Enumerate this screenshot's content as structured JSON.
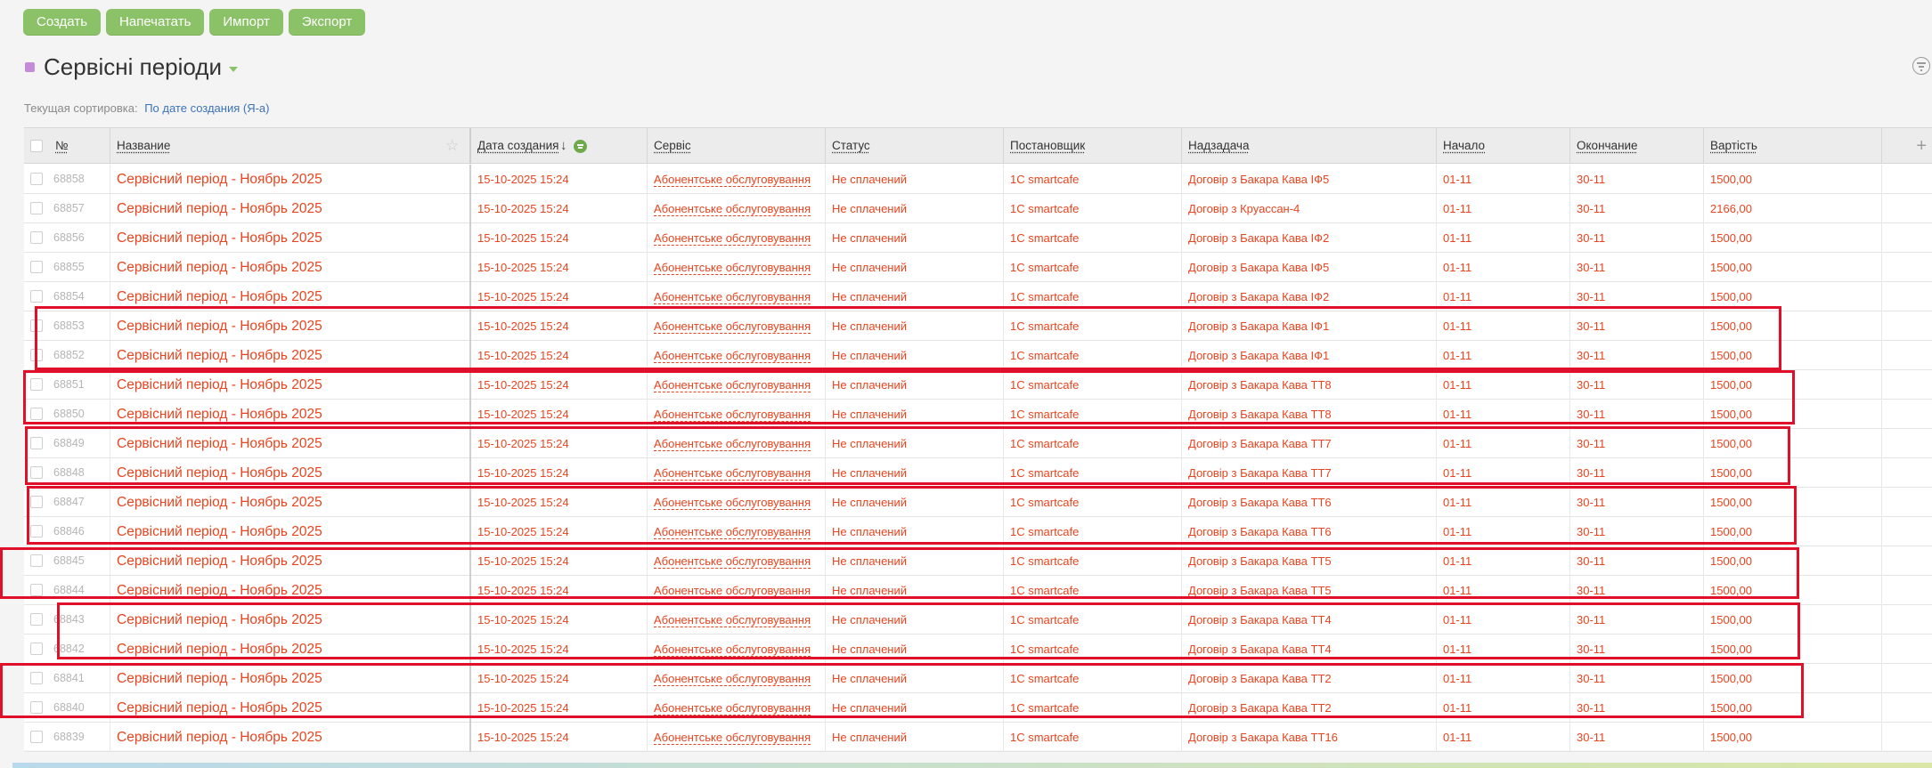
{
  "toolbar": {
    "create": "Создать",
    "print": "Напечатать",
    "import": "Импорт",
    "export": "Экспорт"
  },
  "page_title": "Сервісні періоди",
  "sort": {
    "label": "Текущая сортировка:",
    "value": "По дате создания (Я-а)"
  },
  "columns": {
    "num": "№",
    "name": "Название",
    "created": "Дата создания",
    "service": "Сервіс",
    "status": "Статус",
    "author": "Постановщик",
    "parent": "Надзадача",
    "start": "Начало",
    "end": "Окончание",
    "cost": "Вартість"
  },
  "sort_arrow": "↓",
  "rows": [
    {
      "num": "68858",
      "name": "Сервісний період - Ноябрь 2025",
      "created": "15-10-2025 15:24",
      "service": "Абонентське обслуговування",
      "status": "Не сплачений",
      "author": "1C smartcafe",
      "parent": "Договір з Бакара Кава IФ5",
      "start": "01-11",
      "end": "30-11",
      "cost": "1500,00"
    },
    {
      "num": "68857",
      "name": "Сервісний період - Ноябрь 2025",
      "created": "15-10-2025 15:24",
      "service": "Абонентське обслуговування",
      "status": "Не сплачений",
      "author": "1C smartcafe",
      "parent": "Договір з Круассан-4",
      "start": "01-11",
      "end": "30-11",
      "cost": "2166,00"
    },
    {
      "num": "68856",
      "name": "Сервісний період - Ноябрь 2025",
      "created": "15-10-2025 15:24",
      "service": "Абонентське обслуговування",
      "status": "Не сплачений",
      "author": "1C smartcafe",
      "parent": "Договір з Бакара Кава IФ2",
      "start": "01-11",
      "end": "30-11",
      "cost": "1500,00"
    },
    {
      "num": "68855",
      "name": "Сервісний період - Ноябрь 2025",
      "created": "15-10-2025 15:24",
      "service": "Абонентське обслуговування",
      "status": "Не сплачений",
      "author": "1C smartcafe",
      "parent": "Договір з Бакара Кава IФ5",
      "start": "01-11",
      "end": "30-11",
      "cost": "1500,00"
    },
    {
      "num": "68854",
      "name": "Сервісний період - Ноябрь 2025",
      "created": "15-10-2025 15:24",
      "service": "Абонентське обслуговування",
      "status": "Не сплачений",
      "author": "1C smartcafe",
      "parent": "Договір з Бакара Кава IФ2",
      "start": "01-11",
      "end": "30-11",
      "cost": "1500,00"
    },
    {
      "num": "68853",
      "name": "Сервісний період - Ноябрь 2025",
      "created": "15-10-2025 15:24",
      "service": "Абонентське обслуговування",
      "status": "Не сплачений",
      "author": "1C smartcafe",
      "parent": "Договір з Бакара Кава IФ1",
      "start": "01-11",
      "end": "30-11",
      "cost": "1500,00"
    },
    {
      "num": "68852",
      "name": "Сервісний період - Ноябрь 2025",
      "created": "15-10-2025 15:24",
      "service": "Абонентське обслуговування",
      "status": "Не сплачений",
      "author": "1C smartcafe",
      "parent": "Договір з Бакара Кава IФ1",
      "start": "01-11",
      "end": "30-11",
      "cost": "1500,00"
    },
    {
      "num": "68851",
      "name": "Сервісний період - Ноябрь 2025",
      "created": "15-10-2025 15:24",
      "service": "Абонентське обслуговування",
      "status": "Не сплачений",
      "author": "1C smartcafe",
      "parent": "Договір з Бакара Кава ТТ8",
      "start": "01-11",
      "end": "30-11",
      "cost": "1500,00"
    },
    {
      "num": "68850",
      "name": "Сервісний період - Ноябрь 2025",
      "created": "15-10-2025 15:24",
      "service": "Абонентське обслуговування",
      "status": "Не сплачений",
      "author": "1C smartcafe",
      "parent": "Договір з Бакара Кава ТТ8",
      "start": "01-11",
      "end": "30-11",
      "cost": "1500,00"
    },
    {
      "num": "68849",
      "name": "Сервісний період - Ноябрь 2025",
      "created": "15-10-2025 15:24",
      "service": "Абонентське обслуговування",
      "status": "Не сплачений",
      "author": "1C smartcafe",
      "parent": "Договір з Бакара Кава ТТ7",
      "start": "01-11",
      "end": "30-11",
      "cost": "1500,00"
    },
    {
      "num": "68848",
      "name": "Сервісний період - Ноябрь 2025",
      "created": "15-10-2025 15:24",
      "service": "Абонентське обслуговування",
      "status": "Не сплачений",
      "author": "1C smartcafe",
      "parent": "Договір з Бакара Кава ТТ7",
      "start": "01-11",
      "end": "30-11",
      "cost": "1500,00"
    },
    {
      "num": "68847",
      "name": "Сервісний період - Ноябрь 2025",
      "created": "15-10-2025 15:24",
      "service": "Абонентське обслуговування",
      "status": "Не сплачений",
      "author": "1C smartcafe",
      "parent": "Договір з Бакара Кава ТТ6",
      "start": "01-11",
      "end": "30-11",
      "cost": "1500,00"
    },
    {
      "num": "68846",
      "name": "Сервісний період - Ноябрь 2025",
      "created": "15-10-2025 15:24",
      "service": "Абонентське обслуговування",
      "status": "Не сплачений",
      "author": "1C smartcafe",
      "parent": "Договір з Бакара Кава ТТ6",
      "start": "01-11",
      "end": "30-11",
      "cost": "1500,00"
    },
    {
      "num": "68845",
      "name": "Сервісний період - Ноябрь 2025",
      "created": "15-10-2025 15:24",
      "service": "Абонентське обслуговування",
      "status": "Не сплачений",
      "author": "1C smartcafe",
      "parent": "Договір з Бакара Кава ТТ5",
      "start": "01-11",
      "end": "30-11",
      "cost": "1500,00"
    },
    {
      "num": "68844",
      "name": "Сервісний період - Ноябрь 2025",
      "created": "15-10-2025 15:24",
      "service": "Абонентське обслуговування",
      "status": "Не сплачений",
      "author": "1C smartcafe",
      "parent": "Договір з Бакара Кава ТТ5",
      "start": "01-11",
      "end": "30-11",
      "cost": "1500,00"
    },
    {
      "num": "68843",
      "name": "Сервісний період - Ноябрь 2025",
      "created": "15-10-2025 15:24",
      "service": "Абонентське обслуговування",
      "status": "Не сплачений",
      "author": "1C smartcafe",
      "parent": "Договір з Бакара Кава ТТ4",
      "start": "01-11",
      "end": "30-11",
      "cost": "1500,00"
    },
    {
      "num": "68842",
      "name": "Сервісний період - Ноябрь 2025",
      "created": "15-10-2025 15:24",
      "service": "Абонентське обслуговування",
      "status": "Не сплачений",
      "author": "1C smartcafe",
      "parent": "Договір з Бакара Кава ТТ4",
      "start": "01-11",
      "end": "30-11",
      "cost": "1500,00"
    },
    {
      "num": "68841",
      "name": "Сервісний період - Ноябрь 2025",
      "created": "15-10-2025 15:24",
      "service": "Абонентське обслуговування",
      "status": "Не сплачений",
      "author": "1C smartcafe",
      "parent": "Договір з Бакара Кава ТТ2",
      "start": "01-11",
      "end": "30-11",
      "cost": "1500,00"
    },
    {
      "num": "68840",
      "name": "Сервісний період - Ноябрь 2025",
      "created": "15-10-2025 15:24",
      "service": "Абонентське обслуговування",
      "status": "Не сплачений",
      "author": "1C smartcafe",
      "parent": "Договір з Бакара Кава ТТ2",
      "start": "01-11",
      "end": "30-11",
      "cost": "1500,00"
    },
    {
      "num": "68839",
      "name": "Сервісний період - Ноябрь 2025",
      "created": "15-10-2025 15:24",
      "service": "Абонентське обслуговування",
      "status": "Не сплачений",
      "author": "1C smartcafe",
      "parent": "Договір з Бакара Кава ТТ16",
      "start": "01-11",
      "end": "30-11",
      "cost": "1500,00"
    }
  ],
  "colors": {
    "accent_green": "#8bc267",
    "link_red": "#e8441f",
    "highlight_red": "#e0102b",
    "title_marker": "#c58ad8"
  }
}
